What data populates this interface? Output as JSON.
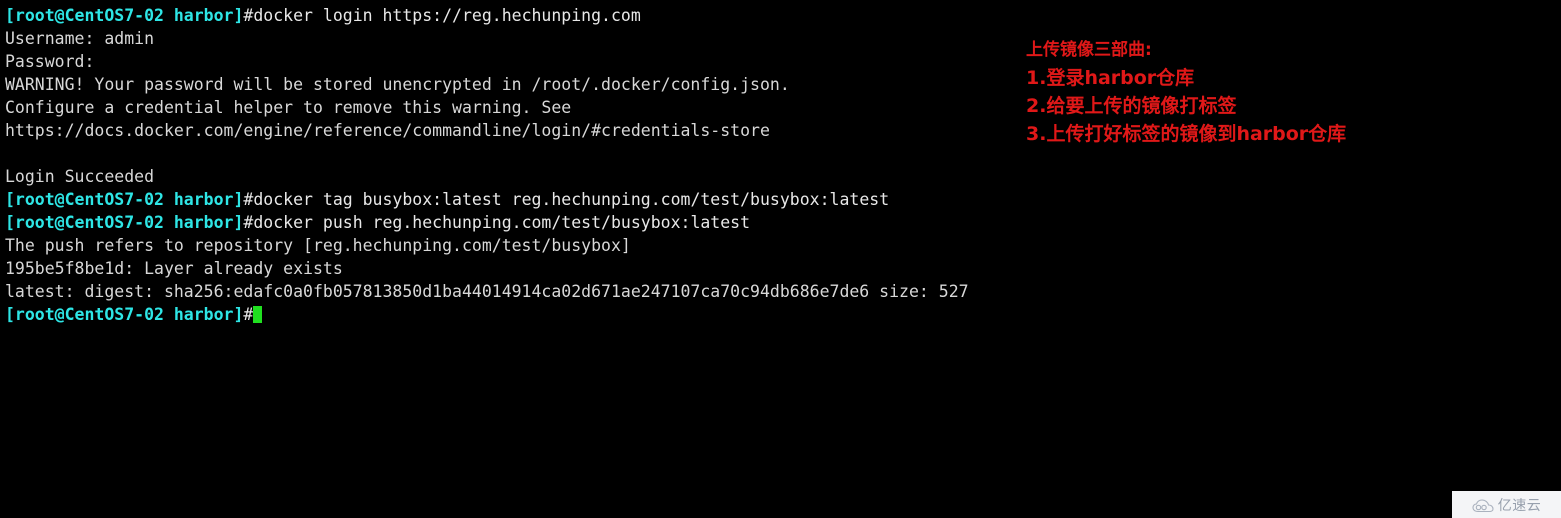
{
  "terminal": {
    "background_color": "#000000",
    "prompt_color": "#2ee6e6",
    "text_color": "#d8d8d8",
    "cursor_color": "#20e020",
    "prompt": "[root@CentOS7-02 harbor]",
    "lines": [
      {
        "type": "command",
        "prompt": "[root@CentOS7-02 harbor]",
        "command": "#docker login https://reg.hechunping.com"
      },
      {
        "type": "output",
        "text": "Username: admin"
      },
      {
        "type": "output",
        "text": "Password:"
      },
      {
        "type": "output",
        "text": "WARNING! Your password will be stored unencrypted in /root/.docker/config.json."
      },
      {
        "type": "output",
        "text": "Configure a credential helper to remove this warning. See"
      },
      {
        "type": "output",
        "text": "https://docs.docker.com/engine/reference/commandline/login/#credentials-store"
      },
      {
        "type": "blank",
        "text": ""
      },
      {
        "type": "output",
        "text": "Login Succeeded"
      },
      {
        "type": "command",
        "prompt": "[root@CentOS7-02 harbor]",
        "command": "#docker tag busybox:latest reg.hechunping.com/test/busybox:latest"
      },
      {
        "type": "command",
        "prompt": "[root@CentOS7-02 harbor]",
        "command": "#docker push reg.hechunping.com/test/busybox:latest"
      },
      {
        "type": "output",
        "text": "The push refers to repository [reg.hechunping.com/test/busybox]"
      },
      {
        "type": "output",
        "text": "195be5f8be1d: Layer already exists"
      },
      {
        "type": "output",
        "text": "latest: digest: sha256:edafc0a0fb057813850d1ba44014914ca02d671ae247107ca70c94db686e7de6 size: 527"
      },
      {
        "type": "cursor",
        "prompt": "[root@CentOS7-02 harbor]",
        "command": "#"
      }
    ]
  },
  "annotation": {
    "color": "#e01818",
    "lines": [
      "上传镜像三部曲:",
      "1.登录harbor仓库",
      "2.给要上传的镜像打标签",
      "3.上传打好标签的镜像到harbor仓库"
    ]
  },
  "watermark": {
    "text": "亿速云",
    "logo_name": "cloud-logo",
    "background_color": "#f4f5f7",
    "text_color": "#97a0ad"
  }
}
